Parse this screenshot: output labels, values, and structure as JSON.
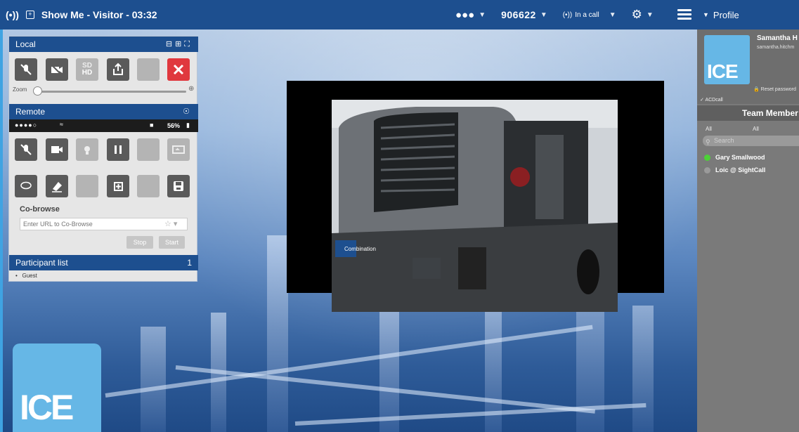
{
  "colors": {
    "header": "#1d4f8f",
    "accent_red": "#e0383e",
    "online": "#4cd137",
    "offline": "#9a9a9a",
    "logo": "#66b7e6"
  },
  "topbar": {
    "title": "Show Me - Visitor - 03:32",
    "call_code": "906622",
    "call_status": "In a call"
  },
  "profile_panel": {
    "header": "Profile",
    "name": "Samantha H",
    "email": "samantha.hitchm",
    "logo_text": "ICE",
    "reset_password": "Reset password",
    "acd": "ACDcall",
    "team_header": "Team Member",
    "filter_1": "All",
    "filter_2": "All",
    "search_placeholder": "Search",
    "members": [
      {
        "name": "Gary Smallwood",
        "status": "online"
      },
      {
        "name": "Loic @ SightCall",
        "status": "offline"
      }
    ]
  },
  "local": {
    "header": "Local",
    "zoom_label": "Zoom",
    "sd_label": "SD",
    "hd_label": "HD"
  },
  "remote": {
    "header": "Remote",
    "battery": "56%"
  },
  "cobrowse": {
    "label": "Co-browse",
    "placeholder": "Enter URL to Co-Browse",
    "stop": "Stop",
    "start": "Start"
  },
  "participants": {
    "header": "Participant list",
    "count": "1",
    "items": [
      "Guest"
    ]
  },
  "video": {
    "badge": "Combination"
  },
  "bottom_logo": "ICE"
}
